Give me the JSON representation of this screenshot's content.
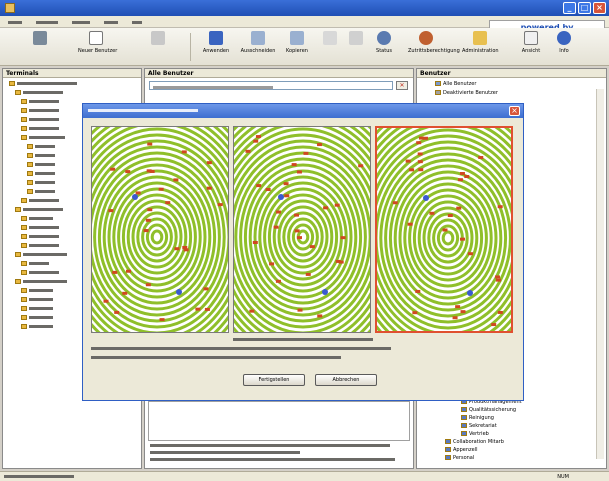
{
  "window": {
    "title": ""
  },
  "menu": {
    "items": [
      "",
      "",
      "",
      "",
      ""
    ]
  },
  "brand": {
    "prefix": "powered by",
    "name": ""
  },
  "toolbar": {
    "buttons": [
      {
        "label": "",
        "icon": "settings-icon"
      },
      {
        "label": "Neuer Benutzer",
        "icon": "new-user-icon"
      },
      {
        "label": "",
        "icon": "user-group-icon"
      },
      {
        "label": "Anwenden",
        "icon": "save-icon"
      },
      {
        "label": "Ausschneiden",
        "icon": "cut-icon"
      },
      {
        "label": "Kopieren",
        "icon": "copy-icon"
      },
      {
        "label": "",
        "icon": "paste-icon"
      },
      {
        "label": "",
        "icon": "delete-icon"
      },
      {
        "label": "Status",
        "icon": "search-icon"
      },
      {
        "label": "Zutrittsberechtigung",
        "icon": "access-icon"
      },
      {
        "label": "Administration",
        "icon": "folder-icon"
      },
      {
        "label": "Ansicht",
        "icon": "view-icon"
      },
      {
        "label": "Info",
        "icon": "info-icon"
      }
    ]
  },
  "terminals": {
    "header": "Terminals",
    "root": ""
  },
  "users": {
    "header": "Alle Benutzer",
    "search_placeholder": ""
  },
  "right_panel": {
    "header": "Benutzer",
    "items": [
      "Alle Benutzer",
      "Deaktivierte Benutzer"
    ],
    "departments": [
      "Produktmanagement",
      "Qualitätssicherung",
      "Reinigung",
      "Sekretariat",
      "Vertrieb",
      "Collaboration Mitarb",
      "Appenzell",
      "Personal"
    ]
  },
  "dialog": {
    "title": "",
    "status": "",
    "instruction_line1": "",
    "instruction_line2": "",
    "ok_label": "Fertigstellen",
    "cancel_label": "Abbrechen"
  },
  "bottom_hint": {
    "line1": "",
    "line2": "",
    "line3": ""
  },
  "statusbar": {
    "text": "",
    "right": "NUM"
  },
  "colors": {
    "accent": "#3d6ed0",
    "ridge": "#8fbf2a",
    "minutia": "#d04820",
    "highlight": "#e05030"
  }
}
